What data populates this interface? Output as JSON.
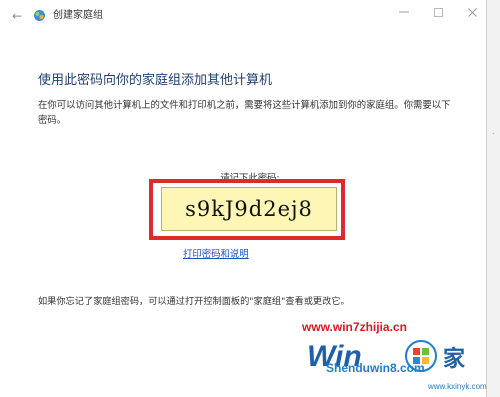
{
  "window": {
    "title": "创建家庭组"
  },
  "content": {
    "heading": "使用此密码向你的家庭组添加其他计算机",
    "description": "在你可以访问其他计算机上的文件和打印机之前，需要将这些计算机添加到你的家庭组。你需要以下密码。",
    "password_prompt": "请记下此密码:",
    "password": "s9kJ9d2ej8",
    "print_link": "打印密码和说明",
    "footer_note": "如果你忘记了家庭组密码，可以通过打开控制面板的\"家庭组\"查看或更改它。"
  },
  "watermark": {
    "url": "www.win7zhijia.cn",
    "site": "Shenduwin8.com",
    "site2": "www.kxinyk.com"
  },
  "colors": {
    "heading": "#1f3f73",
    "link": "#1a53c7",
    "highlight_border": "#e02a2a",
    "password_bg": "#fdf6b4"
  },
  "icons": {
    "back": "back-arrow-icon",
    "app": "homegroup-icon",
    "minimize": "minimize-icon",
    "maximize": "maximize-icon",
    "close": "close-icon"
  }
}
